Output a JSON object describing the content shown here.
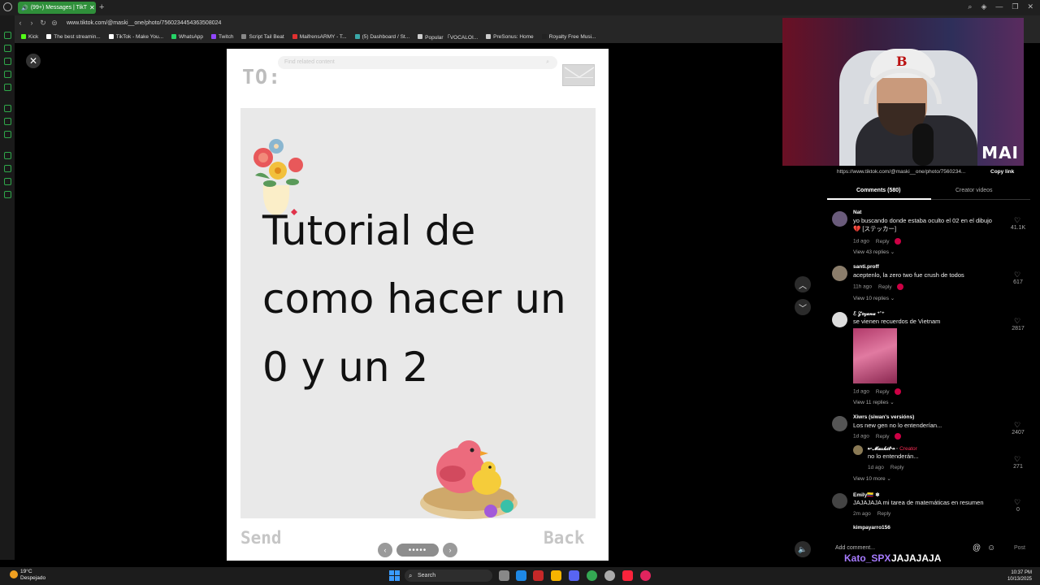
{
  "browser": {
    "tab_title": "(99+) Messages | TikT",
    "url": "www.tiktok.com/@maski__one/photo/7560234454363508024",
    "bookmarks": [
      {
        "label": "Kick",
        "color": "#53fc18"
      },
      {
        "label": "The best streamin...",
        "color": "#ffffff"
      },
      {
        "label": "TikTok - Make You...",
        "color": "#ffffff"
      },
      {
        "label": "WhatsApp",
        "color": "#25d366"
      },
      {
        "label": "Twitch",
        "color": "#9146ff"
      },
      {
        "label": "Script Tail Beat",
        "color": "#888888"
      },
      {
        "label": "MaifrensARMY - T...",
        "color": "#e03030"
      },
      {
        "label": "(5) Dashboard / St...",
        "color": "#3aa8a8"
      },
      {
        "label": "Popular 「VOCALOI...",
        "color": "#cccccc"
      },
      {
        "label": "PreSonus: Home",
        "color": "#cccccc"
      },
      {
        "label": "Royalty Free Musi...",
        "color": "#222222"
      }
    ]
  },
  "post": {
    "search_placeholder": "Find related content",
    "to_label": "TO:",
    "title_lines": [
      "Tutorial de",
      "como hacer un",
      " 0 y un 2"
    ],
    "send_label": "Send",
    "back_label": "Back",
    "pager_dots": "•••••"
  },
  "sidebar": {
    "link": "https://www.tiktok.com/@maski__one/photo/7560234...",
    "copy_link": "Copy link",
    "tab_comments": "Comments (580)",
    "tab_creator": "Creator videos",
    "webcam_watermark": "MAI",
    "comments": [
      {
        "name": "Nat",
        "text": "yo buscando donde estaba oculto el 02 en el dibujo💔 [ステッカー]",
        "time": "1d ago",
        "reply": "Reply",
        "views": "View 43 replies ⌄",
        "likes": "41.1K",
        "avatar": "#6a5b7b"
      },
      {
        "name": "santi.proff",
        "text": "aceptenlo, la zero two fue crush de todos",
        "time": "11h ago",
        "reply": "Reply",
        "views": "View 10 replies ⌄",
        "likes": "617",
        "avatar": "#8b7d6b"
      },
      {
        "name": "ℰ 𝒵𝑜𝓏𝒶𝓃𝒶 ⁺˚⁺",
        "text": "se vienen recuerdos de Vietnam",
        "time": "1d ago",
        "reply": "Reply",
        "views": "View 11 replies ⌄",
        "likes": "2817",
        "avatar": "#ddd"
      },
      {
        "name": "Xiwrs (siwan's versións)",
        "text": "Los new gen no lo entenderían...",
        "time": "1d ago",
        "reply": "Reply",
        "views": "View 10 more ⌄",
        "likes": "2407",
        "avatar": "#555"
      },
      {
        "name": "Emily🇨🇴 ❄",
        "text": "JAJAJAJA mi tarea de matemáticas en resumen",
        "time": "2m ago",
        "reply": "Reply",
        "likes": "0",
        "avatar": "#444"
      },
      {
        "name": "kimpayarro156",
        "avatar": "#333"
      }
    ],
    "creator_reply": {
      "name": "↜𝓜𝓪𝓼𝓴𝓲𝓽↝ ·",
      "badge": "Creator",
      "text": "no lo entenderán...",
      "time": "1d ago",
      "reply": "Reply",
      "likes": "271"
    },
    "add_comment": "Add comment...",
    "post_label": "Post",
    "overlay_user": "Kato_SPX",
    "overlay_msg": "JAJAJAJA"
  },
  "taskbar": {
    "temp": "19°C",
    "weather": "Despejado",
    "search": "Search",
    "time": "10:37 PM",
    "date": "10/13/2025"
  },
  "colors": {
    "accent_green": "#2f8f3a",
    "creator_red": "#ff2d55",
    "overlay_purple": "#a77bff"
  }
}
